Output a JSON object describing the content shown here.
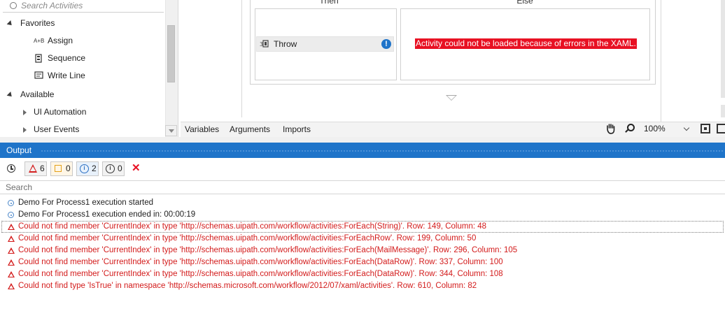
{
  "activities": {
    "search_placeholder": "Search Activities",
    "items": [
      {
        "label": "Favorites",
        "icon": "expanded-triangle"
      },
      {
        "label": "Assign",
        "icon": "assign-icon",
        "glyph": "A+B"
      },
      {
        "label": "Sequence",
        "icon": "sequence-icon"
      },
      {
        "label": "Write Line",
        "icon": "write-line-icon"
      },
      {
        "label": "Available",
        "icon": "expanded-triangle"
      },
      {
        "label": "UI Automation",
        "icon": "collapsed-triangle"
      },
      {
        "label": "User Events",
        "icon": "collapsed-triangle"
      }
    ]
  },
  "designer": {
    "then_label": "Then",
    "else_label": "Else",
    "throw_label": "Throw",
    "error_message": "Activity could not be loaded because of errors in the XAML.",
    "tabs": [
      "Variables",
      "Arguments",
      "Imports"
    ],
    "zoom": "100%"
  },
  "output": {
    "title": "Output",
    "filters": {
      "errors": "6",
      "warnings": "0",
      "info": "2",
      "trace": "0"
    },
    "search_placeholder": "Search",
    "log": [
      {
        "level": "info",
        "text": "Demo For Process1 execution started"
      },
      {
        "level": "info",
        "text": "Demo For Process1 execution ended in: 00:00:19"
      },
      {
        "level": "error",
        "text": "Could not find member 'CurrentIndex' in type 'http://schemas.uipath.com/workflow/activities:ForEach(String)'. Row: 149, Column: 48"
      },
      {
        "level": "error",
        "text": "Could not find member 'CurrentIndex' in type 'http://schemas.uipath.com/workflow/activities:ForEachRow'. Row: 199, Column: 50"
      },
      {
        "level": "error",
        "text": "Could not find member 'CurrentIndex' in type 'http://schemas.uipath.com/workflow/activities:ForEach(MailMessage)'. Row: 296, Column: 105"
      },
      {
        "level": "error",
        "text": "Could not find member 'CurrentIndex' in type 'http://schemas.uipath.com/workflow/activities:ForEach(DataRow)'. Row: 337, Column: 100"
      },
      {
        "level": "error",
        "text": "Could not find member 'CurrentIndex' in type 'http://schemas.uipath.com/workflow/activities:ForEach(DataRow)'. Row: 344, Column: 108"
      },
      {
        "level": "error",
        "text": "Could not find type 'IsTrue' in namespace 'http://schemas.microsoft.com/workflow/2012/07/xaml/activities'. Row: 610, Column: 82"
      }
    ]
  },
  "colors": {
    "accent": "#1f74c9",
    "error": "#d31b1b",
    "error_banner": "#e81123"
  }
}
